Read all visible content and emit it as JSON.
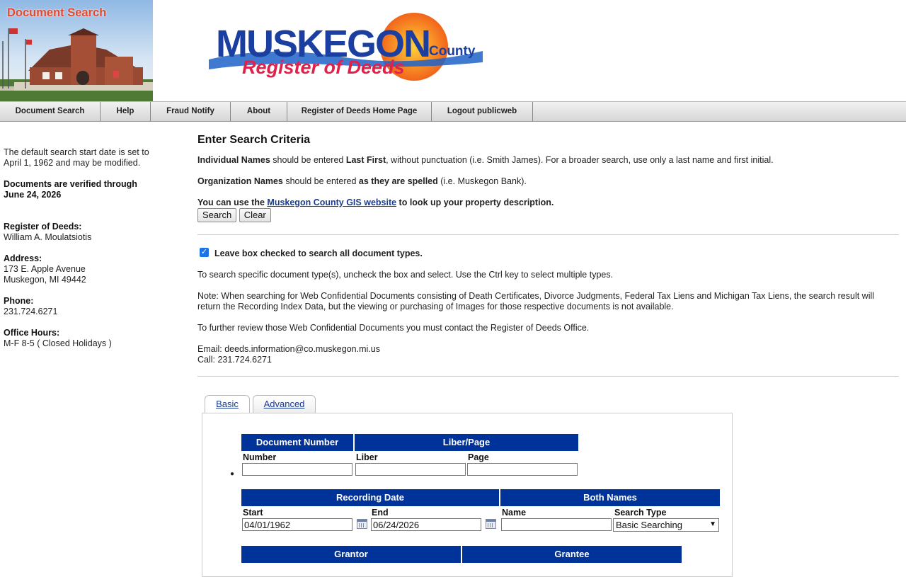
{
  "header": {
    "photo_title": "Document Search",
    "logo_word": "MUSKEGON",
    "logo_county": "County",
    "logo_subtitle": "Register of Deeds"
  },
  "nav": {
    "items": [
      "Document Search",
      "Help",
      "Fraud Notify",
      "About",
      "Register of Deeds Home Page",
      "Logout publicweb"
    ]
  },
  "sidebar": {
    "default_date_note": "The default search start date is set to April 1, 1962 and may be modified.",
    "verified_label": "Documents are verified through",
    "verified_date": "June 24, 2026",
    "register_label": "Register of Deeds:",
    "register_name": "William A. Moulatsiotis",
    "address_label": "Address:",
    "address_line1": "173 E. Apple Avenue",
    "address_line2": "Muskegon, MI 49442",
    "phone_label": "Phone:",
    "phone": "231.724.6271",
    "hours_label": "Office Hours:",
    "hours": "M-F 8-5 ( Closed Holidays )"
  },
  "main": {
    "title": "Enter Search Criteria",
    "individual_bold": "Individual Names",
    "individual_mid": " should be entered ",
    "individual_bold2": "Last First",
    "individual_rest": ", without punctuation (i.e. Smith James). For a broader search, use only a last name and first initial.",
    "org_bold": "Organization Names",
    "org_mid": " should be entered ",
    "org_bold2": "as they are spelled",
    "org_rest": " (i.e. Muskegon Bank).",
    "gis_pre": "You can use the ",
    "gis_link": "Muskegon County GIS website",
    "gis_post": " to look up your property description.",
    "search_button": "Search",
    "clear_button": "Clear",
    "all_types_label": "Leave box checked to search all document types.",
    "all_types_checked": true,
    "specific_types_note": "To search specific document type(s), uncheck the box and select. Use the Ctrl key to select multiple types.",
    "confidential_note": "Note: When searching for Web Confidential Documents consisting of Death Certificates, Divorce Judgments, Federal Tax Liens and Michigan Tax Liens, the search result will return the Recording Index Data, but the viewing or purchasing of Images for those respective documents is not available.",
    "further_review": "To further review those Web Confidential Documents you must contact the Register of Deeds Office.",
    "email_line": "Email: deeds.information@co.muskegon.mi.us",
    "call_line": "Call: 231.724.6271"
  },
  "tabs": [
    "Basic",
    "Advanced"
  ],
  "form": {
    "doc_number_header": "Document Number",
    "liber_page_header": "Liber/Page",
    "number_label": "Number",
    "liber_label": "Liber",
    "page_label": "Page",
    "recording_date_header": "Recording Date",
    "both_names_header": "Both Names",
    "start_label": "Start",
    "end_label": "End",
    "name_label": "Name",
    "search_type_label": "Search Type",
    "start_value": "04/01/1962",
    "end_value": "06/24/2026",
    "search_type_value": "Basic Searching",
    "grantor_header": "Grantor",
    "grantee_header": "Grantee"
  }
}
